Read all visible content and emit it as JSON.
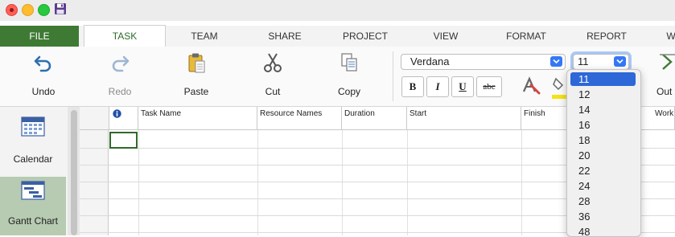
{
  "window": {
    "controls": [
      "close",
      "minimize",
      "zoom"
    ],
    "save_icon": "floppy-disk-icon"
  },
  "tabs": [
    "FILE",
    "TASK",
    "TEAM",
    "SHARE",
    "PROJECT",
    "VIEW",
    "FORMAT",
    "REPORT",
    "W"
  ],
  "active_tab": "TASK",
  "ribbon": {
    "undo": "Undo",
    "redo": "Redo",
    "paste": "Paste",
    "cut": "Cut",
    "copy": "Copy",
    "outline": "Out",
    "font_name": "Verdana",
    "font_size": "11",
    "bold": "B",
    "italic": "I",
    "underline": "U",
    "strikethrough": "abc"
  },
  "font_size_options": [
    "11",
    "12",
    "14",
    "16",
    "18",
    "20",
    "22",
    "24",
    "28",
    "36",
    "48"
  ],
  "selected_font_size": "11",
  "views": [
    "Calendar",
    "Gantt Chart"
  ],
  "active_view": "Gantt Chart",
  "columns": [
    "Task Name",
    "Resource Names",
    "Duration",
    "Start",
    "Finish",
    "Work"
  ],
  "colors": {
    "file_tab": "#3f7a35",
    "accent": "#2e6b2a",
    "selection_blue": "#2d67d8",
    "active_view_bg": "#b6cbb1"
  }
}
